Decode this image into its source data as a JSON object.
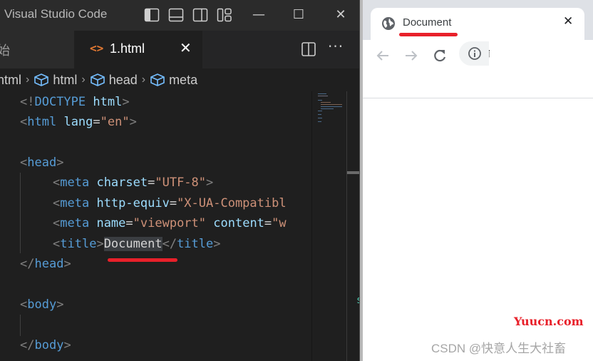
{
  "vscode": {
    "window_title": "Visual Studio Code",
    "layout_icons": [
      "toggle-primary-sidebar-icon",
      "toggle-panel-icon",
      "toggle-secondary-sidebar-icon",
      "customize-layout-icon"
    ],
    "window_controls": {
      "minimize": "—",
      "maximize": "☐",
      "close": "✕"
    },
    "tabs": [
      {
        "label": "始",
        "active": false
      },
      {
        "label": "1.html",
        "active": true,
        "icon": "<>",
        "close": "✕"
      }
    ],
    "tab_actions": {
      "split": "split-editor-icon",
      "more": "···"
    },
    "breadcrumb": [
      {
        "label": "html",
        "icon": null
      },
      {
        "label": "html",
        "icon": "symbol-element-icon"
      },
      {
        "label": "head",
        "icon": "symbol-element-icon"
      },
      {
        "label": "meta",
        "icon": "symbol-element-icon"
      }
    ],
    "breadcrumb_sep": "›",
    "code": {
      "doctype_open": "<!",
      "doctype_kw": "DOCTYPE",
      "doctype_val": "html",
      "doctype_close": ">",
      "html_tag": "html",
      "lang_attr": "lang",
      "lang_val": "\"en\"",
      "head_tag": "head",
      "meta_tag": "meta",
      "charset_attr": "charset",
      "charset_val": "\"UTF-8\"",
      "http_equiv_attr": "http-equiv",
      "http_equiv_val": "\"X-UA-Compatibl",
      "name_attr": "name",
      "name_val": "\"viewport\"",
      "content_attr": "content",
      "content_val": "\"w",
      "title_tag": "title",
      "title_text": "Document",
      "body_tag": "body",
      "lt": "<",
      "gt": ">",
      "lt_slash": "</",
      "eq": "=",
      "sp": " "
    },
    "minimap_stray_char": "s"
  },
  "browser": {
    "tab_title": "Document",
    "tab_close": "✕",
    "nav": {
      "back": "←",
      "forward": "→",
      "reload": "⟳"
    },
    "address": ""
  },
  "annotations": {
    "underline_color": "#e8202a"
  },
  "watermarks": {
    "site": "Yuucn.com",
    "author": "CSDN @快意人生大社畜"
  }
}
